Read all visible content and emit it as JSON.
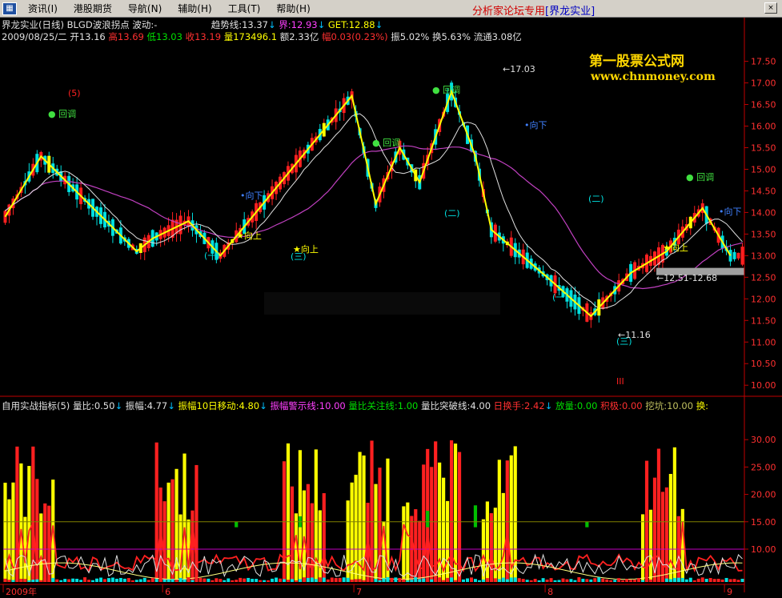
{
  "menubar": {
    "items": [
      "资讯(I)",
      "港股期货",
      "导航(N)",
      "辅助(H)",
      "工具(T)",
      "帮助(H)"
    ],
    "forum_text": "分析家论坛专用",
    "stock_tag": "[界龙实业]",
    "close_icon": "×"
  },
  "header": {
    "title": "界龙实业(日线)",
    "indicator": "BLGD波浪拐点",
    "wave_label": "波动:-",
    "trend_label": "趋势线:13.37",
    "jie_label": "界:12.93",
    "get_label": "GET:12.88"
  },
  "quote": {
    "date": "2009/08/25/二",
    "open": "开13.16",
    "high": "高13.69",
    "low": "低13.03",
    "close": "收13.19",
    "volume": "量173496.1",
    "amount": "额2.33亿",
    "change": "幅0.03(0.23%)",
    "amplitude": "振5.02%",
    "turnover": "换5.63%",
    "float": "流通3.08亿"
  },
  "watermark": {
    "line1": "第一股票公式网",
    "line2": "www.chnmoney.com"
  },
  "lower_header": {
    "name": "自用实战指标(5)",
    "vol_ratio": "量比:0.50",
    "amplitude": "振幅:4.77",
    "amp_ma10": "振幅10日移动:4.80",
    "amp_warn": "振幅警示线:10.00",
    "vol_focus": "量比关注线:1.00",
    "vol_break": "量比突破线:4.00",
    "daily_turnover": "日换手:2.42",
    "vol_release": "放量:0.00",
    "accumulate": "积极:0.00",
    "dig_pit": "挖坑:10.00",
    "swap": "换:"
  },
  "markers": {
    "huitiao": "回调",
    "xiangshang": "向上",
    "xiangxia": "向下",
    "range_label": "12.51-12.68",
    "low_label": "←11.16",
    "peak_label": "←17.03",
    "num1": "(一)",
    "num2": "(二)",
    "num3": "(三)",
    "num5": "(5)",
    "roman3": "III"
  },
  "colors": {
    "up": "#ff2020",
    "down": "#00e0e0",
    "yellow": "#ffff00",
    "magenta": "#c040c0",
    "axis": "#c00000"
  },
  "chart_data": [
    {
      "type": "candlestick",
      "title": "界龙实业(日线)",
      "y_ticks": [
        "17.50",
        "17.00",
        "16.50",
        "16.00",
        "15.50",
        "15.00",
        "14.50",
        "14.00",
        "13.50",
        "13.00",
        "12.50",
        "12.00",
        "11.50",
        "11.00",
        "10.50",
        "10.00"
      ],
      "ylim": [
        9.8,
        17.9
      ],
      "x_tick_labels": [
        "2009年",
        "6",
        "7",
        "8",
        "9"
      ],
      "zigzag_points": [
        {
          "i": 0,
          "v": 13.9
        },
        {
          "i": 9,
          "v": 15.3
        },
        {
          "i": 33,
          "v": 13.1
        },
        {
          "i": 37,
          "v": 13.4
        },
        {
          "i": 46,
          "v": 13.8
        },
        {
          "i": 54,
          "v": 13.0
        },
        {
          "i": 87,
          "v": 16.7
        },
        {
          "i": 93,
          "v": 14.2
        },
        {
          "i": 99,
          "v": 15.5
        },
        {
          "i": 104,
          "v": 14.7
        },
        {
          "i": 112,
          "v": 16.8
        },
        {
          "i": 118,
          "v": 15.3
        },
        {
          "i": 122,
          "v": 13.6
        },
        {
          "i": 136,
          "v": 12.5
        },
        {
          "i": 147,
          "v": 11.6
        },
        {
          "i": 157,
          "v": 12.6
        },
        {
          "i": 166,
          "v": 13.1
        },
        {
          "i": 175,
          "v": 14.1
        },
        {
          "i": 182,
          "v": 13.0
        }
      ],
      "levels": {
        "peak": 17.03,
        "low": 11.16,
        "range_low": 12.51,
        "range_high": 12.68,
        "last_close": 13.19
      }
    },
    {
      "type": "bar",
      "title": "自用实战指标(5)",
      "y_ticks": [
        "30.00",
        "25.00",
        "20.00",
        "15.00",
        "10.00"
      ],
      "ylim": [
        4,
        35
      ],
      "warn_line": 10.0,
      "focus_line": 15.0
    }
  ]
}
